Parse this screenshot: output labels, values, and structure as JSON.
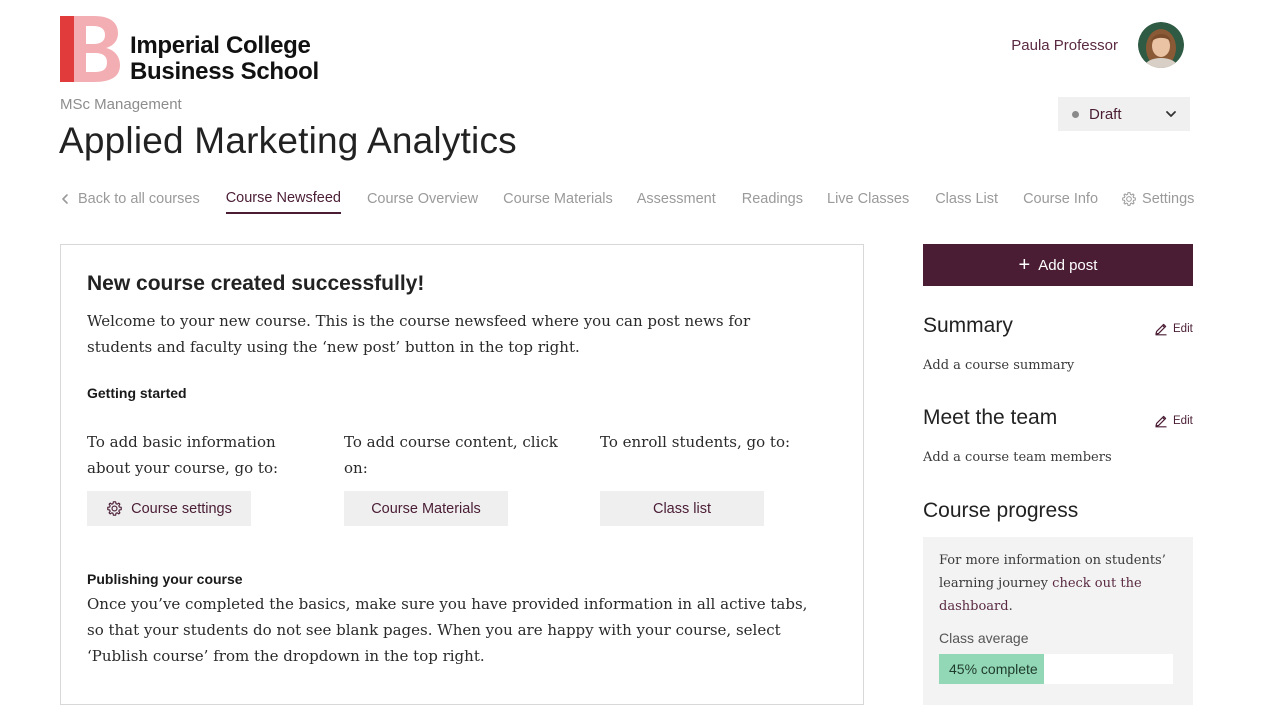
{
  "brand": {
    "name_line1": "Imperial College",
    "name_line2": "Business School",
    "logo_color_primary": "#e23b3b",
    "logo_color_secondary": "#f2aeb3",
    "accent": "#4a1d35",
    "progress_color": "#92d8b6"
  },
  "user": {
    "name": "Paula Professor",
    "avatar_icon": "user-avatar-photo"
  },
  "status": {
    "selected": "Draft",
    "icon": "chevron-down-icon"
  },
  "course": {
    "program": "MSc Management",
    "title": "Applied Marketing Analytics"
  },
  "tabs": [
    {
      "label": "Back to all courses"
    },
    {
      "label": "Course Newsfeed"
    },
    {
      "label": "Course Overview"
    },
    {
      "label": "Course Materials"
    },
    {
      "label": "Assessment"
    },
    {
      "label": "Readings"
    },
    {
      "label": "Live Classes"
    },
    {
      "label": "Class List"
    },
    {
      "label": "Course Info"
    },
    {
      "label": "Settings"
    }
  ],
  "active_tab": "Course Newsfeed",
  "main": {
    "heading": "New course created successfully!",
    "welcome": "Welcome to your new course. This is the course newsfeed where you can post news for students and faculty using the ‘new post’ button in the top right.",
    "getting_started": "Getting started",
    "columns": [
      {
        "text": "To add basic information about your course, go to:",
        "button": "Course settings"
      },
      {
        "text": "To add course content, click on:",
        "button": "Course Materials"
      },
      {
        "text": "To enroll students, go to:",
        "button": "Class list"
      }
    ],
    "publishing_heading": "Publishing your course",
    "publishing_text": "Once you’ve completed the basics, make sure you have provided information in all active tabs, so that your students do not see blank pages. When you are happy with your course, select ‘Publish course’ from the dropdown in the top right."
  },
  "sidebar": {
    "add_post": "Add post",
    "summary_heading": "Summary",
    "summary_edit": "Edit",
    "summary_text": "Add a course summary",
    "team_heading": "Meet the team",
    "team_edit": "Edit",
    "team_text": "Add a course team members",
    "progress_heading": "Course progress",
    "progress_info_prefix": "For more information on students’ learning journey ",
    "progress_info_link": "check out the dashboard",
    "progress_info_suffix": ".",
    "class_average_label": "Class average",
    "progress_percent": 45,
    "progress_label": "45% complete"
  }
}
